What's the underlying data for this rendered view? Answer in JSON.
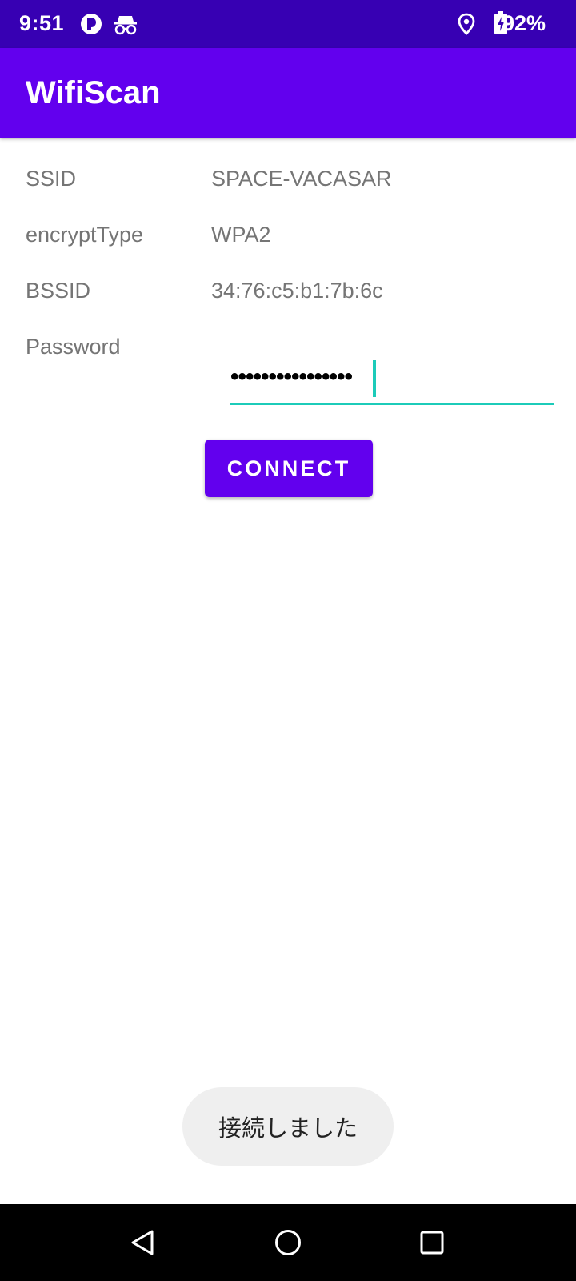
{
  "status_bar": {
    "time": "9:51",
    "battery": "92%",
    "icons": [
      "app-notification-icon",
      "incognito-icon",
      "location-icon",
      "battery-charging-icon"
    ]
  },
  "app_bar": {
    "title": "WifiScan"
  },
  "details": {
    "ssid_label": "SSID",
    "ssid_value": "SPACE-VACASAR",
    "encrypt_label": "encryptType",
    "encrypt_value": "WPA2",
    "bssid_label": "BSSID",
    "bssid_value": "34:76:c5:b1:7b:6c",
    "password_label": "Password",
    "password_value": "••••••••••••••••"
  },
  "connect_button": {
    "label": "CONNECT"
  },
  "toast": {
    "message": "接続しました"
  },
  "nav_bar": {
    "buttons": [
      "back",
      "home",
      "recents"
    ]
  },
  "colors": {
    "status_bar": "#3700b3",
    "primary": "#6200ee",
    "accent": "#1ccbb9"
  }
}
